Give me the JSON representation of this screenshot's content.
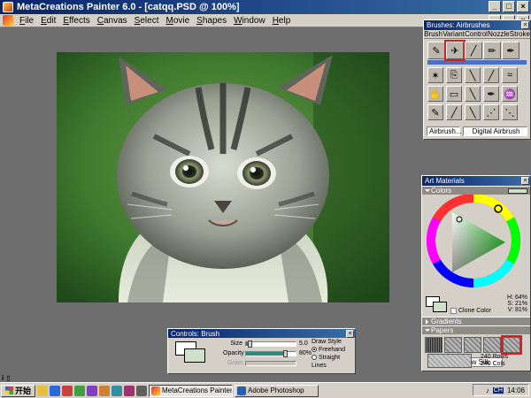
{
  "window": {
    "title": "MetaCreations Painter 6.0 - [catqq.PSD @ 100%]"
  },
  "menu": [
    "File",
    "Edit",
    "Effects",
    "Canvas",
    "Select",
    "Movie",
    "Shapes",
    "Window",
    "Help"
  ],
  "brushes": {
    "title": "Brushes: Airbrushes",
    "tabs": [
      "Brush",
      "Variant",
      "Control",
      "Nozzle",
      "Stroke"
    ],
    "category": "Airbrush...",
    "variant": "Digital Airbrush"
  },
  "art_materials": {
    "title": "Art Materials",
    "colors_label": "Colors",
    "hsv": [
      "H: 64%",
      "S: 21%",
      "V: 81%"
    ],
    "clone_color_label": "Clone Color",
    "gradients_label": "Gradients",
    "papers_label": "Papers",
    "paper_name": "Raw Silk",
    "paper_rows": "240 Rows",
    "paper_cols": "240 Cols",
    "current_color": "#cfe0cb"
  },
  "controls": {
    "title": "Controls: Brush",
    "size_label": "Size",
    "size_value": "5.0",
    "opacity_label": "Opacity",
    "opacity_value": "80%",
    "opacity_fraction": 0.8,
    "size_fraction": 0.05,
    "grain_label": "Grain",
    "draw_style_label": "Draw Style",
    "freehand_label": "Freehand",
    "straight_lines_label": "Straight Lines"
  },
  "taskbar": {
    "start_label": "开始",
    "tasks": [
      "MetaCreations Painter 6....",
      "Adobe Photoshop"
    ],
    "lang": "CH",
    "clock": "14:06"
  }
}
